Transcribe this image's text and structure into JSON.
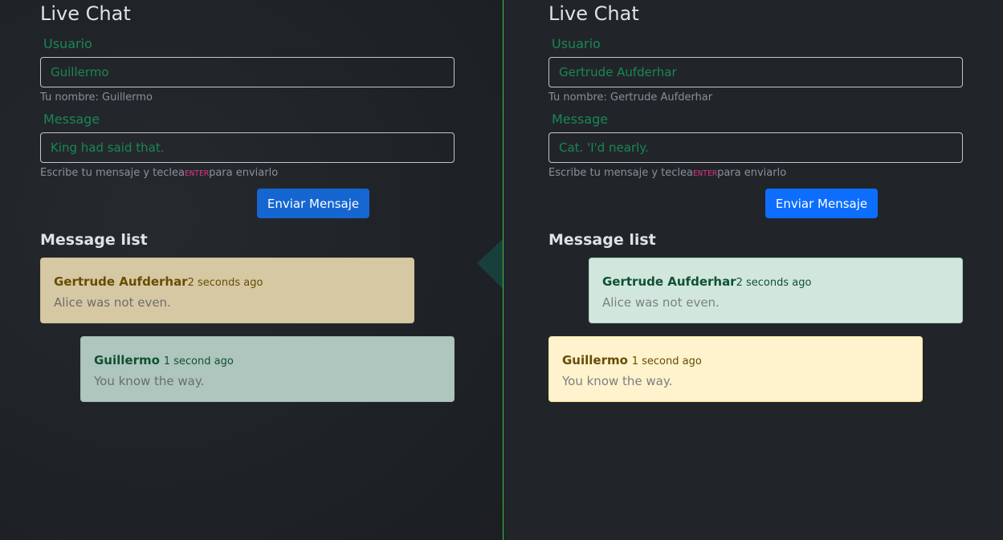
{
  "left": {
    "title": "Live Chat",
    "user_label": "Usuario",
    "user_value": "Guillermo",
    "user_help": "Tu nombre: Guillermo",
    "message_label": "Message",
    "message_value": "King had said that.",
    "hint_before": "Escribe tu mensaje y teclea",
    "hint_key": "ENTER",
    "hint_after": "para enviarlo",
    "send_label": "Enviar Mensaje",
    "list_heading": "Message list",
    "messages": [
      {
        "author": "Gertrude Aufderhar",
        "time": "2 seconds ago",
        "text": "Alice was not even.",
        "style": "warning",
        "align": "left"
      },
      {
        "author": "Guillermo",
        "time": "1 second ago",
        "text": "You know the way.",
        "style": "success",
        "align": "right"
      }
    ]
  },
  "right": {
    "title": "Live Chat",
    "user_label": "Usuario",
    "user_value": "Gertrude Aufderhar",
    "user_help": "Tu nombre: Gertrude Aufderhar",
    "message_label": "Message",
    "message_value": "Cat. 'I'd nearly.",
    "hint_before": "Escribe tu mensaje y teclea",
    "hint_key": "ENTER",
    "hint_after": "para enviarlo",
    "send_label": "Enviar Mensaje",
    "list_heading": "Message list",
    "messages": [
      {
        "author": "Gertrude Aufderhar",
        "time": "2 seconds ago",
        "text": "Alice was not even.",
        "style": "success",
        "align": "right"
      },
      {
        "author": "Guillermo",
        "time": "1 second ago",
        "text": "You know the way.",
        "style": "warning",
        "align": "left"
      }
    ]
  },
  "colors": {
    "accent_green": "#198754",
    "button_blue": "#0d6efd",
    "divider_green": "#3fbf3f",
    "kbd_pink": "#d63384"
  }
}
